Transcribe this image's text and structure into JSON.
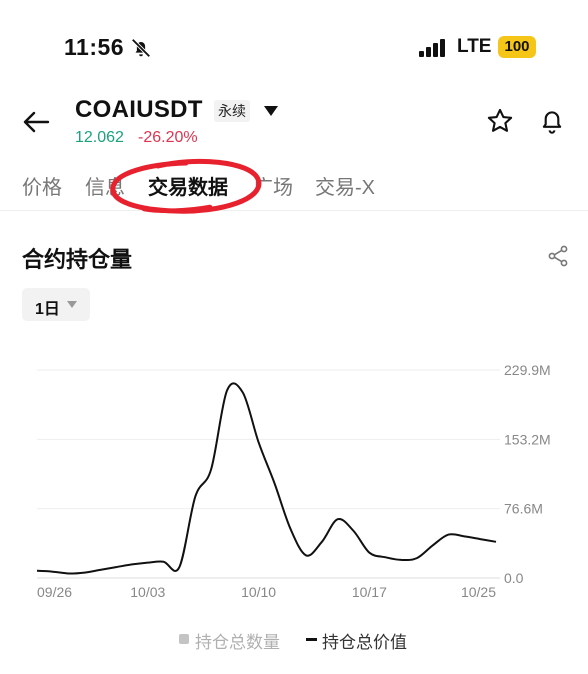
{
  "status_bar": {
    "time": "11:56",
    "mute_icon": "bell-slash-icon",
    "network": "LTE",
    "battery": "100"
  },
  "header": {
    "back_icon": "arrow-left-icon",
    "symbol": "COAIUSDT",
    "contract_type": "永续",
    "price": "12.062",
    "change": "-26.20%",
    "price_color": "#1aa37a",
    "change_color": "#e0334f"
  },
  "tabs": [
    {
      "label": "价格",
      "active": false
    },
    {
      "label": "信息",
      "active": false
    },
    {
      "label": "交易数据",
      "active": true
    },
    {
      "label": "广场",
      "active": false
    },
    {
      "label": "交易-X",
      "active": false
    }
  ],
  "section": {
    "title": "合约持仓量",
    "share_icon": "share-icon",
    "interval": "1日"
  },
  "chart_data": {
    "type": "line",
    "title": "",
    "x_tick_labels": [
      "09/26",
      "10/03",
      "10/10",
      "10/17",
      "10/25"
    ],
    "y_tick_labels": [
      "229.9M",
      "153.2M",
      "76.6M",
      "0.0"
    ],
    "ylim": [
      0,
      229.9
    ],
    "x": [
      "09/26",
      "09/27",
      "09/28",
      "09/29",
      "09/30",
      "10/01",
      "10/02",
      "10/03",
      "10/04",
      "10/05",
      "10/06",
      "10/07",
      "10/08",
      "10/09",
      "10/10",
      "10/11",
      "10/12",
      "10/13",
      "10/14",
      "10/15",
      "10/16",
      "10/17",
      "10/18",
      "10/19",
      "10/20",
      "10/21",
      "10/22",
      "10/23",
      "10/24",
      "10/25"
    ],
    "series": [
      {
        "name": "持仓总价值",
        "color": "#111111",
        "values": [
          8,
          7,
          5,
          6,
          9,
          12,
          15,
          17,
          18,
          12,
          90,
          120,
          207,
          205,
          150,
          105,
          55,
          25,
          40,
          65,
          52,
          28,
          23,
          20,
          22,
          36,
          48,
          46,
          43,
          40
        ]
      }
    ],
    "grid": true,
    "legend_position": "bottom"
  },
  "legend": [
    {
      "label": "持仓总数量",
      "enabled": false
    },
    {
      "label": "持仓总价值",
      "enabled": true
    }
  ],
  "annotation_color": "#e8212e"
}
